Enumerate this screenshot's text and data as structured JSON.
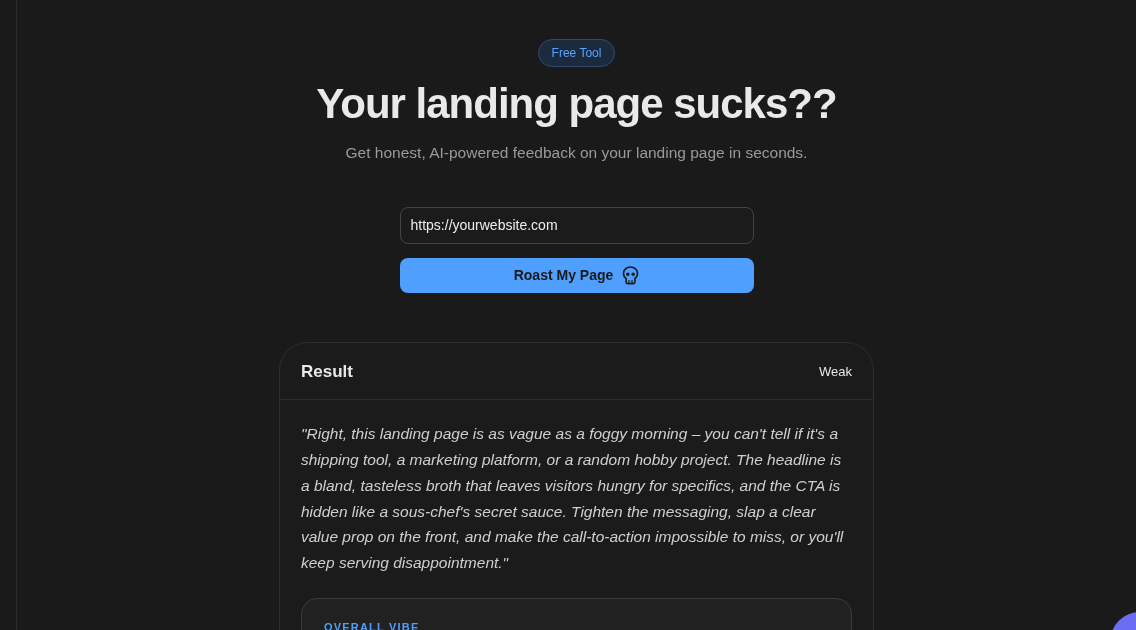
{
  "badge": "Free Tool",
  "headline": "Your landing page sucks??",
  "subheadline": "Get honest, AI-powered feedback on your landing page in seconds.",
  "url_field": {
    "value": "https://yourwebsite.com"
  },
  "submit_button": {
    "label": "Roast My Page"
  },
  "result": {
    "title": "Result",
    "rating": "Weak",
    "feedback": "\"Right, this landing page is as vague as a foggy morning – you can't tell if it's a shipping tool, a marketing platform, or a random hobby project. The headline is a bland, tasteless broth that leaves visitors hungry for specifics, and the CTA is hidden like a sous-chef's secret sauce. Tighten the messaging, slap a clear value prop on the front, and make the call-to-action impossible to miss, or you'll keep serving disappointment.\"",
    "sections": [
      {
        "label": "OVERALL VIBE"
      }
    ]
  }
}
